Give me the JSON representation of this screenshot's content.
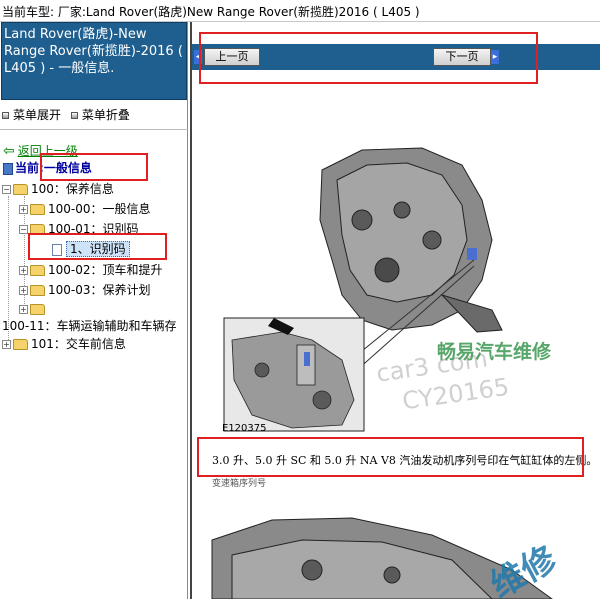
{
  "window": {
    "title": "当前车型:  厂家:Land Rover(路虎)New Range Rover(新揽胜)2016 ( L405 )"
  },
  "sidebar": {
    "header": "Land Rover(路虎)-New Range Rover(新揽胜)-2016 ( L405 ) - 一般信息.",
    "expand_all": "菜单展开",
    "collapse_all": "菜单折叠",
    "back": "返回上一级",
    "current_prefix": "当前:",
    "current_value": "一般信息",
    "tree": [
      {
        "label": "100：保养信息"
      },
      {
        "label": "100-00：一般信息"
      },
      {
        "label": "100-01：识别码"
      },
      {
        "label": "1、识别码"
      },
      {
        "label": "100-02：顶车和提升"
      },
      {
        "label": "100-03：保养计划"
      },
      {
        "label": ""
      },
      {
        "label": "100-11：车辆运输辅助和车辆存"
      },
      {
        "label": "101：交车前信息"
      }
    ]
  },
  "nav": {
    "prev": "上一页",
    "next": "下一页",
    "bar_color": "#1f5f8f"
  },
  "content": {
    "figure_ref": "E120375",
    "caption": "3.0 升、5.0 升 SC 和 5.0 升 NA V8 汽油发动机序列号印在气缸缸体的左侧。",
    "sub_caption": "变速箱序列号",
    "watermark_brand": "畅易汽车维修",
    "watermark_site": "car3 com",
    "watermark_code": "CY20165",
    "watermark_bottom": "维修"
  },
  "colors": {
    "header_blue": "#1f5f8f",
    "highlight_red": "#e02020",
    "link_green": "#008000"
  }
}
